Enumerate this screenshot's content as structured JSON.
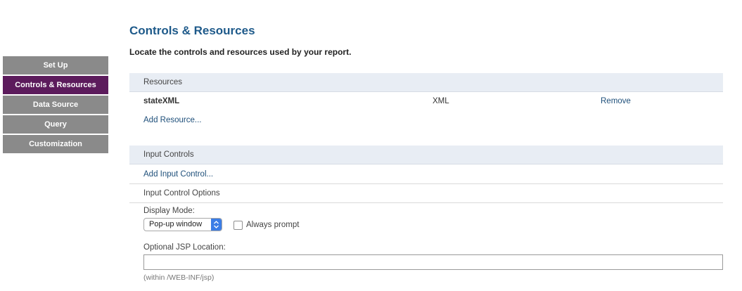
{
  "sidebar": {
    "items": [
      {
        "label": "Set Up",
        "active": false
      },
      {
        "label": "Controls & Resources",
        "active": true
      },
      {
        "label": "Data Source",
        "active": false
      },
      {
        "label": "Query",
        "active": false
      },
      {
        "label": "Customization",
        "active": false
      }
    ]
  },
  "main": {
    "title": "Controls & Resources",
    "subtitle": "Locate the controls and resources used by your report.",
    "resources": {
      "header": "Resources",
      "items": [
        {
          "name": "stateXML",
          "type": "XML",
          "action": "Remove"
        }
      ],
      "add_link": "Add Resource..."
    },
    "input_controls": {
      "header": "Input Controls",
      "add_link": "Add Input Control...",
      "options_label": "Input Control Options",
      "display_mode_label": "Display Mode:",
      "display_mode_value": "Pop-up window",
      "always_prompt_label": "Always prompt",
      "always_prompt_checked": false,
      "jsp_label": "Optional JSP Location:",
      "jsp_value": "",
      "jsp_hint": "(within /WEB-INF/jsp)"
    }
  },
  "colors": {
    "title": "#1e5a8a",
    "sidebar_active": "#5c1b5c",
    "sidebar_inactive": "#8a8a8a",
    "section_header_bg": "#e8edf4",
    "link": "#1e4f7a"
  }
}
